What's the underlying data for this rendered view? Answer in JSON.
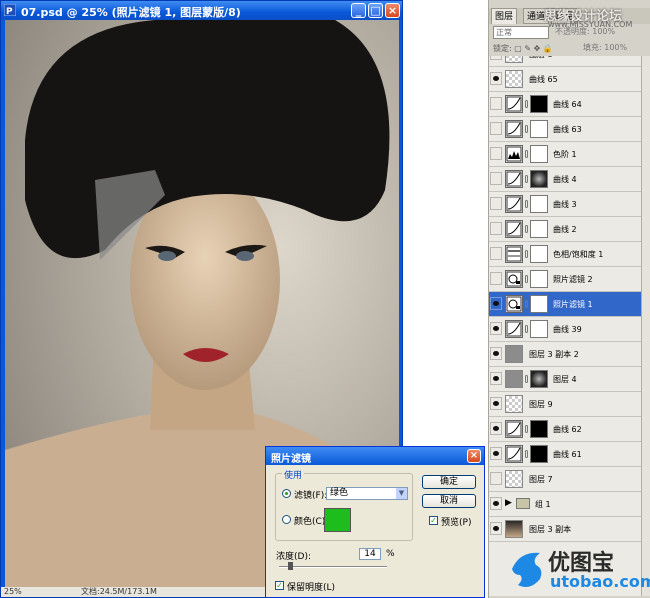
{
  "document": {
    "title": "07.psd @ 25% (照片滤镜 1, 图层蒙版/8)",
    "status_zoom": "25%",
    "status_doc": "文档:24.5M/173.1M"
  },
  "panel": {
    "tabs": [
      "图层",
      "通道",
      "路径"
    ],
    "blend_mode": "正常",
    "opacity_label": "不透明度: 100%",
    "lock_label": "锁定:",
    "fill_label": "填充: 100%"
  },
  "layers": [
    {
      "name": "图层 8",
      "visible": false,
      "type": "pixel"
    },
    {
      "name": "曲线 65",
      "visible": true,
      "type": "pixel"
    },
    {
      "name": "曲线 64",
      "visible": false,
      "type": "curves",
      "mask": "black"
    },
    {
      "name": "曲线 63",
      "visible": false,
      "type": "curves",
      "mask": "white"
    },
    {
      "name": "色阶 1",
      "visible": false,
      "type": "levels",
      "mask": "white"
    },
    {
      "name": "曲线 4",
      "visible": false,
      "type": "curves",
      "mask": "face"
    },
    {
      "name": "曲线 3",
      "visible": false,
      "type": "curves",
      "mask": "white"
    },
    {
      "name": "曲线 2",
      "visible": false,
      "type": "curves",
      "mask": "white"
    },
    {
      "name": "色相/饱和度 1",
      "visible": false,
      "type": "hue",
      "mask": "white"
    },
    {
      "name": "照片滤镜 2",
      "visible": false,
      "type": "photo",
      "mask": "white"
    },
    {
      "name": "照片滤镜 1",
      "visible": true,
      "type": "photo",
      "mask": "white",
      "selected": true
    },
    {
      "name": "曲线 39",
      "visible": true,
      "type": "curves",
      "mask": "white"
    },
    {
      "name": "图层 3 副本 2",
      "visible": true,
      "type": "gray"
    },
    {
      "name": "图层 4",
      "visible": true,
      "type": "gray",
      "mask": "face"
    },
    {
      "name": "图层 9",
      "visible": true,
      "type": "pixel"
    },
    {
      "name": "曲线 62",
      "visible": true,
      "type": "curves",
      "mask": "black"
    },
    {
      "name": "曲线 61",
      "visible": true,
      "type": "curves",
      "mask": "black"
    },
    {
      "name": "图层 7",
      "visible": false,
      "type": "pixel"
    },
    {
      "name": "组 1",
      "visible": true,
      "type": "group"
    },
    {
      "name": "图层 3 副本",
      "visible": true,
      "type": "photo_thumb"
    }
  ],
  "dialog": {
    "title": "照片滤镜",
    "group_label": "使用",
    "filter_label": "滤镜(F):",
    "filter_value": "绿色",
    "color_label": "颜色(C):",
    "color_swatch": "#1dbd1d",
    "ok": "确定",
    "cancel": "取消",
    "preview_label": "预览(P)",
    "density_label": "浓度(D):",
    "density_value": "14",
    "density_unit": "%",
    "preserve_label": "保留明度(L)"
  },
  "watermark": {
    "top_text": "思缘设计论坛",
    "top_url": "www.MISSYUAN.COM",
    "brand_name": "优图宝",
    "brand_url": "utobao.com"
  }
}
